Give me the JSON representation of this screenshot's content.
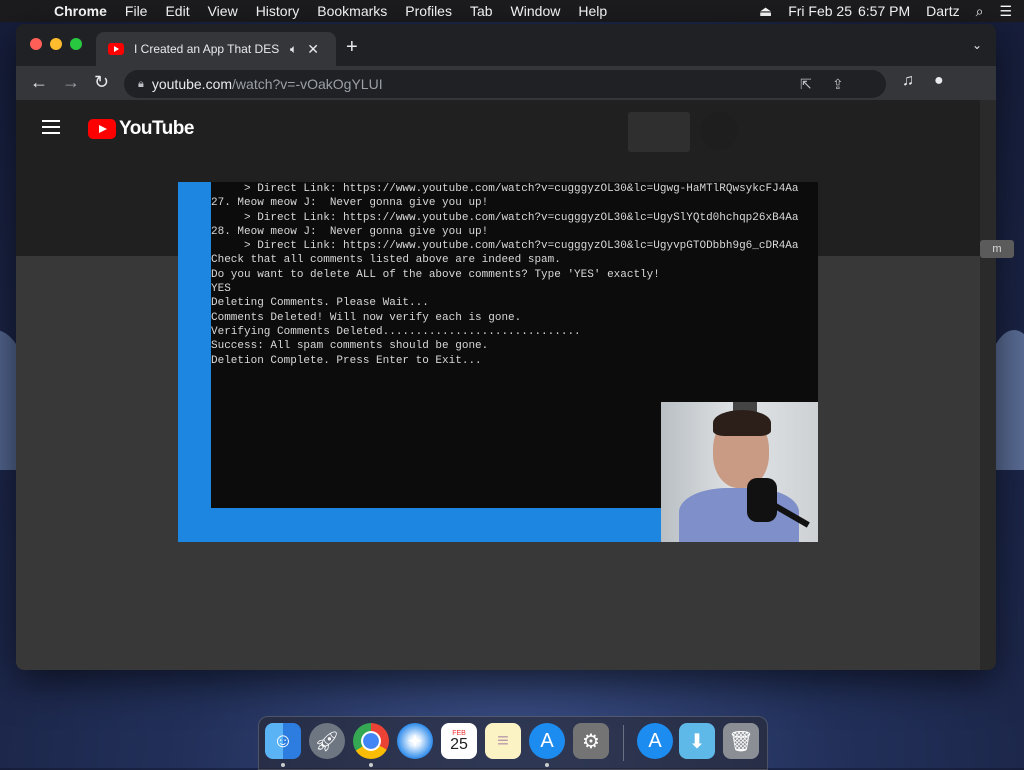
{
  "menubar": {
    "apple_icon": "",
    "items": [
      "Chrome",
      "File",
      "Edit",
      "View",
      "History",
      "Bookmarks",
      "Profiles",
      "Tab",
      "Window",
      "Help"
    ],
    "date": "Fri Feb 25",
    "time": "6:57 PM",
    "user": "Dartz"
  },
  "browser": {
    "tab_title": "I Created an App That DES",
    "url_host": "youtube.com",
    "url_path": "/watch?v=-vOakOgYLUI"
  },
  "youtube": {
    "logo_text": "YouTube",
    "side_chip": "m"
  },
  "console": {
    "lines": [
      "     > Direct Link: https://www.youtube.com/watch?v=cugggyzOL30&lc=Ugwg-HaMTlRQwsykcFJ4Aa",
      "",
      "27. Meow meow J:  Never gonna give you up!",
      "     > Direct Link: https://www.youtube.com/watch?v=cugggyzOL30&lc=UgySlYQtd0hchqp26xB4Aa",
      "",
      "28. Meow meow J:  Never gonna give you up!",
      "     > Direct Link: https://www.youtube.com/watch?v=cugggyzOL30&lc=UgyvpGTODbbh9g6_cDR4Aa",
      "",
      "",
      "",
      "Check that all comments listed above are indeed spam.",
      "Do you want to delete ALL of the above comments? Type 'YES' exactly!",
      "YES",
      "",
      "",
      "Deleting Comments. Please Wait...",
      "Comments Deleted! Will now verify each is gone.",
      "",
      "Verifying Comments Deleted..............................",
      "",
      "Success: All spam comments should be gone.",
      "",
      "Deletion Complete. Press Enter to Exit..."
    ]
  },
  "dock": {
    "calendar_month": "FEB",
    "calendar_day": "25"
  }
}
